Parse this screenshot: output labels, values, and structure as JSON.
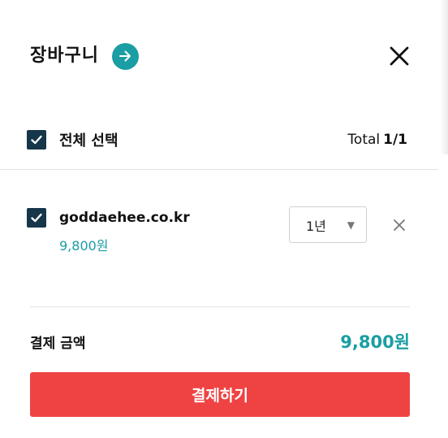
{
  "header": {
    "title": "장바구니",
    "go_icon": "arrow-right-icon",
    "close_icon": "close-icon"
  },
  "select_all": {
    "label": "전체 선택",
    "checked": true,
    "total_label": "Total",
    "total_count": "1/1"
  },
  "items": [
    {
      "name": "goddaehee.co.kr",
      "price": "9,800원",
      "checked": true,
      "period": "1년",
      "remove_icon": "close-icon"
    }
  ],
  "summary": {
    "label": "결제 금액",
    "amount": "9,800원"
  },
  "checkout": {
    "label": "결제하기"
  },
  "colors": {
    "accent": "#1a9ea3",
    "checkbox": "#16364a",
    "checkout_button": "#ef4343",
    "divider": "#e3e3e3"
  }
}
